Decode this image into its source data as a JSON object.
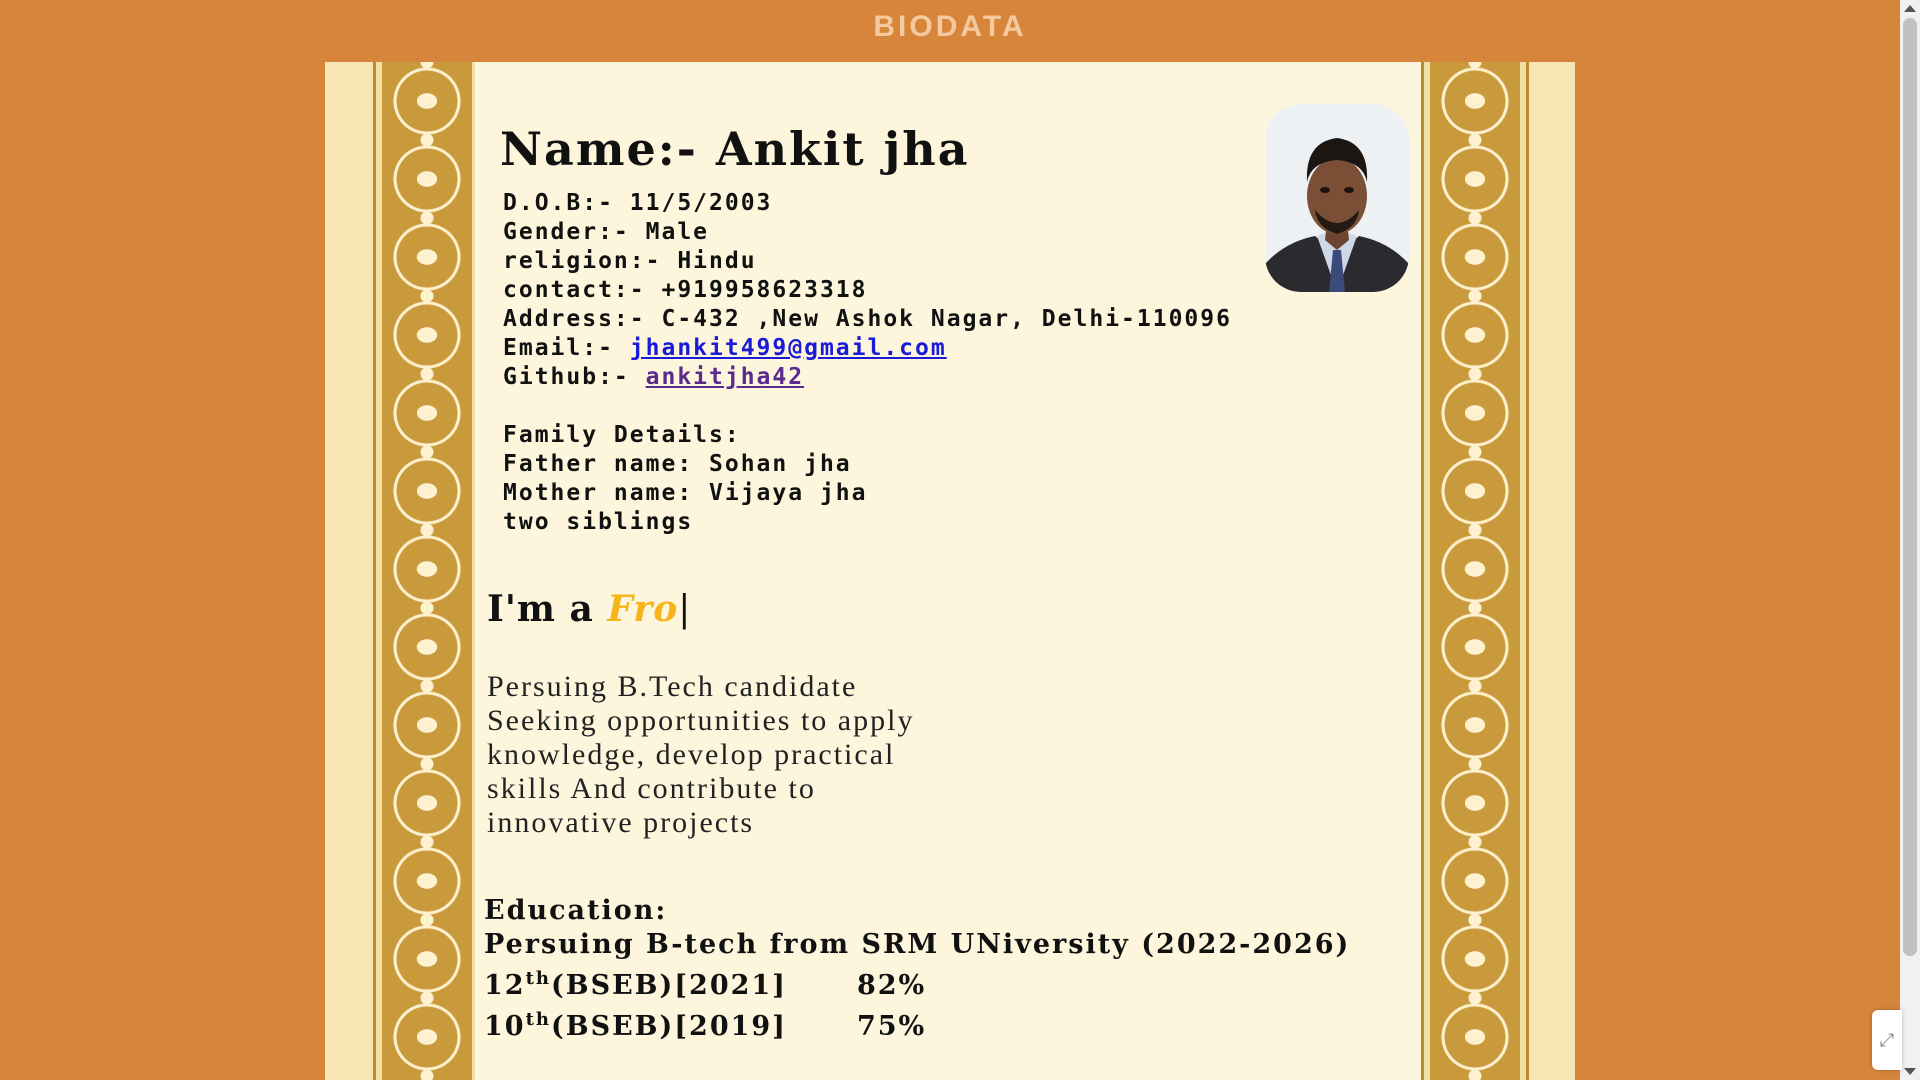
{
  "header": {
    "title": "BIODATA"
  },
  "profile": {
    "name": "Name:- Ankit jha",
    "dob": "D.O.B:- 11/5/2003",
    "gender": "Gender:- Male",
    "religion": "religion:- Hindu",
    "contact": "contact:- +919958623318",
    "address": "Address:- C-432 ,New Ashok Nagar, Delhi-110096",
    "email_label": "Email:- ",
    "email": "jhankit499@gmail.com",
    "github_label": "Github:- ",
    "github": "ankitjha42",
    "photo_icon": "portrait-photo"
  },
  "family": {
    "heading": "Family Details:",
    "father": "Father name: Sohan jha",
    "mother": "Mother name: Vijaya jha",
    "siblings": "two siblings"
  },
  "intro": {
    "prefix": "I'm a ",
    "role": "Fro",
    "caret": "|"
  },
  "summary": {
    "lines": [
      "Persuing B.Tech candidate",
      "Seeking opportunities to apply",
      "knowledge, develop practical",
      "skills And contribute to",
      "innovative projects"
    ]
  },
  "education": {
    "heading": "Education:",
    "degree": "Persuing B-tech from SRM UNiversity (2022-2026)",
    "rows": [
      {
        "grade": "12",
        "suffix": "th",
        "board": "(BSEB)[2021]",
        "score": "82%"
      },
      {
        "grade": "10",
        "suffix": "th",
        "board": "(BSEB)[2019]",
        "score": "75%"
      }
    ]
  },
  "colors": {
    "background": "#d7853a",
    "sheet": "#fdf6dd",
    "border": "#c99a3b",
    "link": "#1a1ad9",
    "accent": "#f4b41a"
  },
  "icons": {
    "scroll_up": "arrow-up-icon",
    "scroll_down": "arrow-down-icon",
    "corner_widget": "link-icon"
  }
}
